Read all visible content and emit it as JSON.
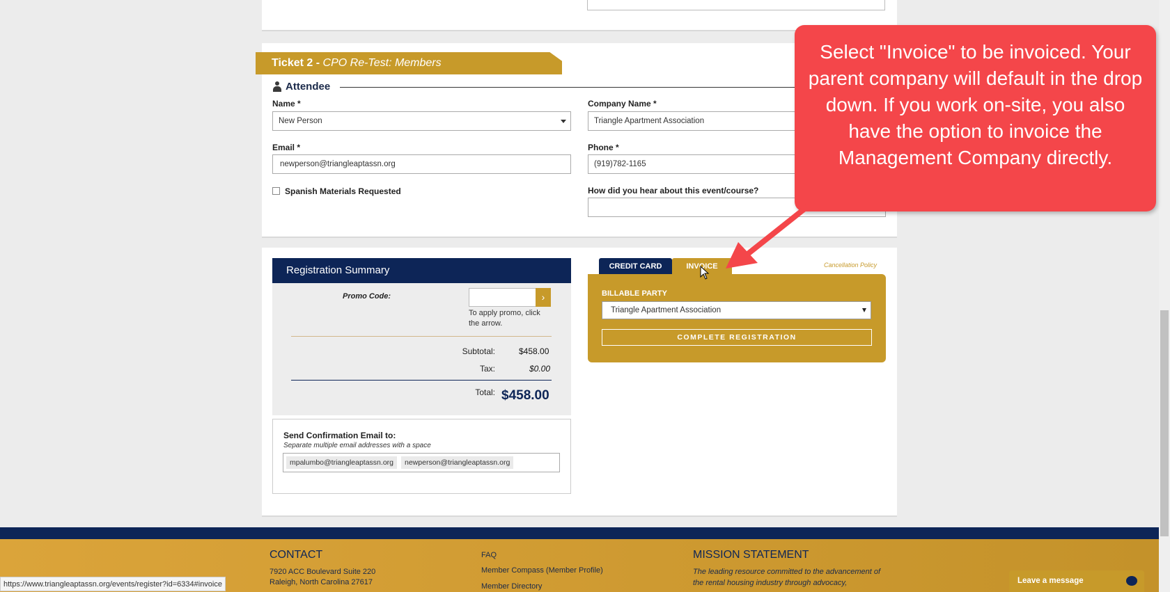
{
  "ticket": {
    "title_prefix": "Ticket 2 - ",
    "title_event": "CPO Re-Test: Members",
    "attendee_heading": "Attendee",
    "name_label": "Name *",
    "name_value": "New Person",
    "company_label": "Company Name *",
    "company_value": "Triangle Apartment Association",
    "email_label": "Email *",
    "email_value": "newperson@triangleaptassn.org",
    "phone_label": "Phone *",
    "phone_value": "(919)782-1165",
    "spanish_label": "Spanish Materials Requested",
    "hear_label": "How did you hear about this event/course?"
  },
  "summary": {
    "heading": "Registration Summary",
    "promo_label": "Promo Code:",
    "promo_arrow": "›",
    "promo_hint": "To apply promo, click the arrow.",
    "subtotal_label": "Subtotal:",
    "subtotal_value": "$458.00",
    "tax_label": "Tax:",
    "tax_value": "$0.00",
    "total_label": "Total:",
    "total_value": "$458.00",
    "confirm_label": "Send Confirmation Email to:",
    "confirm_hint": "Separate multiple email addresses with a space",
    "emails": [
      "mpalumbo@triangleaptassn.org",
      "newperson@triangleaptassn.org"
    ]
  },
  "payment": {
    "tab_credit": "CREDIT CARD",
    "tab_invoice": "INVOICE",
    "cancellation": "Cancellation Policy",
    "billable_label": "BILLABLE PARTY",
    "billable_value": "Triangle Apartment Association",
    "complete_button": "COMPLETE REGISTRATION"
  },
  "footer": {
    "contact_heading": "CONTACT",
    "address1": "7920 ACC Boulevard Suite 220",
    "address2": "Raleigh, North Carolina 27617",
    "links": [
      "FAQ",
      "Member Compass (Member Profile)",
      "Member Directory"
    ],
    "mission_heading": "MISSION STATEMENT",
    "mission_text": "The leading resource committed to the advancement of the rental housing industry through advocacy,"
  },
  "callout": {
    "text": "Select \"Invoice\" to be invoiced. Your parent company will default in the drop down. If you work on-site, you also have the option to invoice the Management Company directly."
  },
  "status_url": "https://www.triangleaptassn.org/events/register?id=6334#invoice",
  "chat": {
    "label": "Leave a message"
  },
  "colors": {
    "navy": "#0d2557",
    "gold": "#c79a2a",
    "callout": "#f4464a"
  }
}
